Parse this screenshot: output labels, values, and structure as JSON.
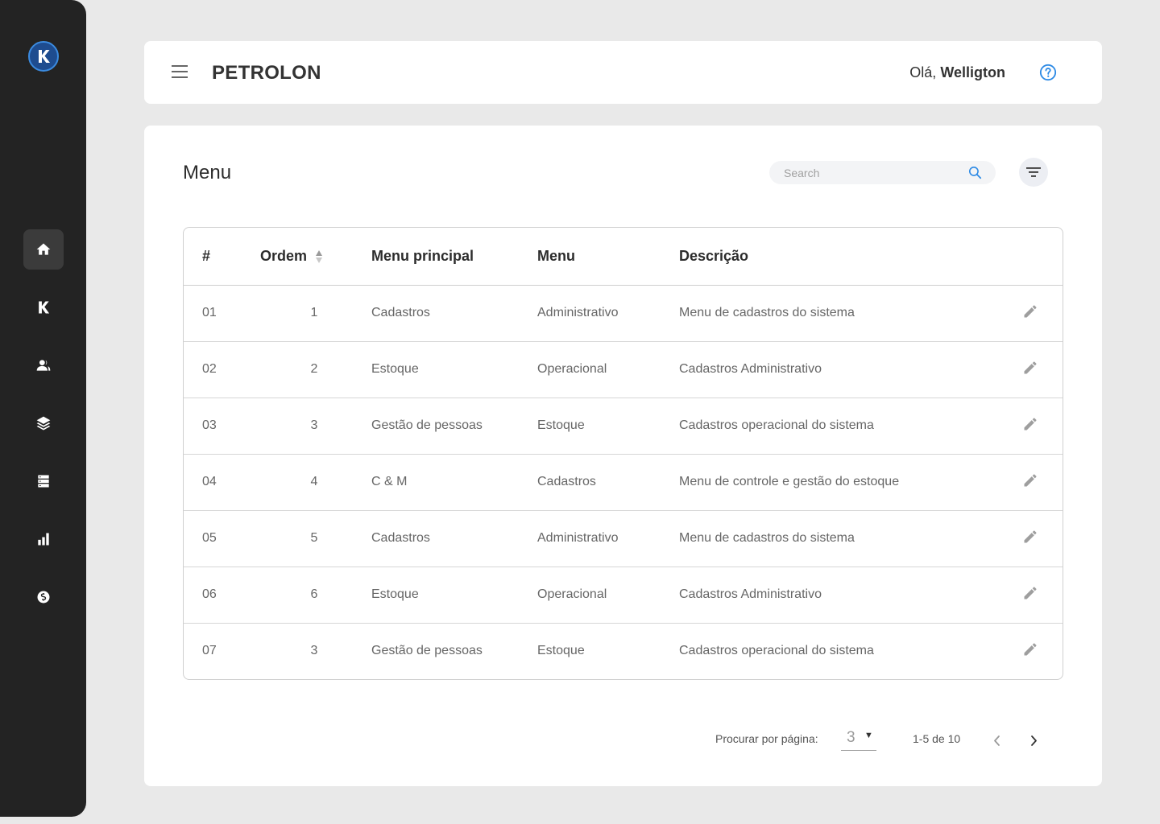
{
  "sidebar": {
    "logo_icon": "k-logo-icon",
    "items": [
      {
        "name": "home",
        "icon": "home-icon",
        "active": true
      },
      {
        "name": "k",
        "icon": "k-icon"
      },
      {
        "name": "users",
        "icon": "users-icon"
      },
      {
        "name": "layers",
        "icon": "layers-icon"
      },
      {
        "name": "database",
        "icon": "database-icon"
      },
      {
        "name": "reports",
        "icon": "bar-chart-icon"
      },
      {
        "name": "finance",
        "icon": "dollar-icon"
      }
    ]
  },
  "header": {
    "title": "PETROLON",
    "greeting": "Olá,",
    "user": "Welligton"
  },
  "main": {
    "title": "Menu",
    "search_placeholder": "Search",
    "table": {
      "columns": [
        "#",
        "Ordem",
        "Menu principal",
        "Menu",
        "Descrição"
      ],
      "rows": [
        {
          "num": "01",
          "ordem": "1",
          "principal": "Cadastros",
          "menu": "Administrativo",
          "descricao": "Menu de cadastros do sistema"
        },
        {
          "num": "02",
          "ordem": "2",
          "principal": "Estoque",
          "menu": "Operacional",
          "descricao": "Cadastros Administrativo"
        },
        {
          "num": "03",
          "ordem": "3",
          "principal": "Gestão de pessoas",
          "menu": "Estoque",
          "descricao": "Cadastros operacional do sistema"
        },
        {
          "num": "04",
          "ordem": "4",
          "principal": "C & M",
          "menu": "Cadastros",
          "descricao": "Menu de controle e gestão do estoque"
        },
        {
          "num": "05",
          "ordem": "5",
          "principal": "Cadastros",
          "menu": "Administrativo",
          "descricao": "Menu de cadastros do sistema"
        },
        {
          "num": "06",
          "ordem": "6",
          "principal": "Estoque",
          "menu": "Operacional",
          "descricao": "Cadastros Administrativo"
        },
        {
          "num": "07",
          "ordem": "3",
          "principal": "Gestão de pessoas",
          "menu": "Estoque",
          "descricao": "Cadastros operacional do sistema"
        }
      ]
    },
    "pagination": {
      "label": "Procurar por página:",
      "per_page": "3",
      "range": "1-5 de 10"
    }
  },
  "colors": {
    "sidebar_bg": "#232323",
    "accent": "#2d8ae5",
    "background": "#e9e9e9"
  }
}
